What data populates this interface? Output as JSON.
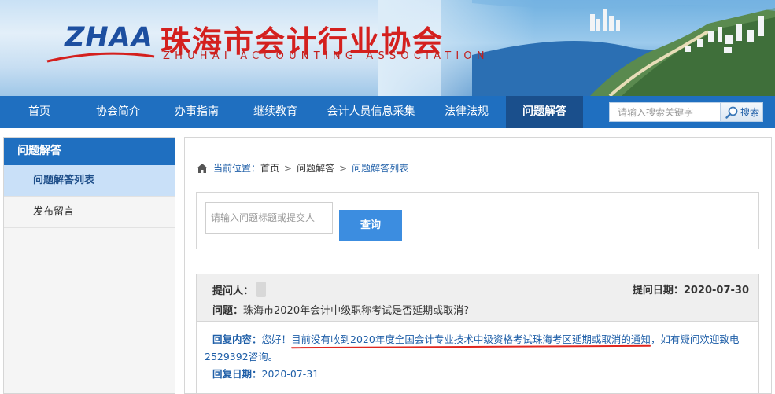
{
  "header": {
    "logo_abbr": "ZHAA",
    "logo_cn": "珠海市会计行业协会",
    "logo_en": "ZHUHAI ACCOUNTING ASSOCIATION"
  },
  "nav": {
    "items": [
      {
        "label": "首页"
      },
      {
        "label": "协会简介"
      },
      {
        "label": "办事指南"
      },
      {
        "label": "继续教育"
      },
      {
        "label": "会计人员信息采集"
      },
      {
        "label": "法律法规"
      },
      {
        "label": "问题解答"
      }
    ],
    "active_index": 6,
    "search_placeholder": "请输入搜索关键字",
    "search_button": "搜索"
  },
  "sidebar": {
    "title": "问题解答",
    "items": [
      {
        "label": "问题解答列表"
      },
      {
        "label": "发布留言"
      }
    ]
  },
  "breadcrumb": {
    "prefix": "当前位置：",
    "items": [
      "首页",
      "问题解答",
      "问题解答列表"
    ],
    "separator": ">"
  },
  "query": {
    "placeholder": "请输入问题标题或提交人",
    "button": "查询"
  },
  "qa": {
    "asker_label": "提问人：",
    "date_label": "提问日期：",
    "date": "2020-07-30",
    "question_label": "问题：",
    "question": "珠海市2020年会计中级职称考试是否延期或取消?",
    "reply_label": "回复内容：",
    "reply_greeting": "您好！",
    "reply_emph": "目前没有收到2020年度全国会计专业技术中级资格考试珠海考区延期或取消的通知",
    "reply_tail": "，如有疑问欢迎致电2529392咨询。",
    "reply_date_label": "回复日期：",
    "reply_date": "2020-07-31"
  },
  "colors": {
    "nav_bg": "#1f6fc0",
    "nav_active_bg": "#1a4f8c",
    "logo_red": "#d4201e",
    "logo_blue": "#1d4fa0",
    "link_blue": "#1f5fa8",
    "button_blue": "#3c8de0",
    "underline_red": "#e0261e"
  }
}
